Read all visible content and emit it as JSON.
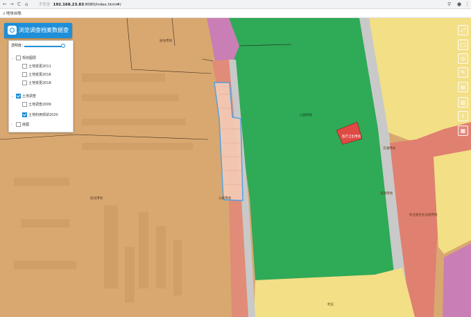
{
  "browser": {
    "back": "←",
    "forward": "→",
    "reload": "C",
    "home": "⌂",
    "insecure": "不安全",
    "url_host": "192.168.23.83",
    "url_path": ":8080/index.html#/"
  },
  "tab": {
    "icon": "ↄ",
    "title": "地块台账"
  },
  "app": {
    "title": "浏览调查档案数据查询系统"
  },
  "panel": {
    "opacity_label": "透明度：",
    "opacity_value": 0.95,
    "layers": [
      {
        "label": "规划图层",
        "level": 1,
        "checked": false,
        "expanded": true
      },
      {
        "label": "土地变更2011",
        "level": 2,
        "checked": false
      },
      {
        "label": "土地变更2016",
        "level": 2,
        "checked": false
      },
      {
        "label": "土地变更2018",
        "level": 2,
        "checked": false
      },
      {
        "label": "土地调查",
        "level": 1,
        "checked": true,
        "expanded": true
      },
      {
        "label": "土地调查2009",
        "level": 2,
        "checked": false
      },
      {
        "label": "土地利用现状2020",
        "level": 2,
        "checked": true
      },
      {
        "label": "底图",
        "level": 1,
        "checked": false,
        "expanded": false
      }
    ]
  },
  "map_labels": [
    "居住用地",
    "居住用地",
    "公园绿地",
    "医疗卫生用地",
    "商业服务业设施用地",
    "公路用地",
    "交通用地",
    "道路用地",
    "村庄"
  ],
  "tools": [
    "zoom-extent-icon",
    "select-icon",
    "measure-icon",
    "draw-icon",
    "export-icon",
    "delete-icon",
    "upload-icon",
    "print-icon"
  ],
  "colors": {
    "residential": "#d9a870",
    "green": "#2faa57",
    "road": "#c9c9c9",
    "commercial": "#e08070",
    "yellow": "#f2df86",
    "pink": "#c97fb5",
    "medical": "#e04a45",
    "selection": "#4aa2e8",
    "accent": "#1e8fd8"
  }
}
